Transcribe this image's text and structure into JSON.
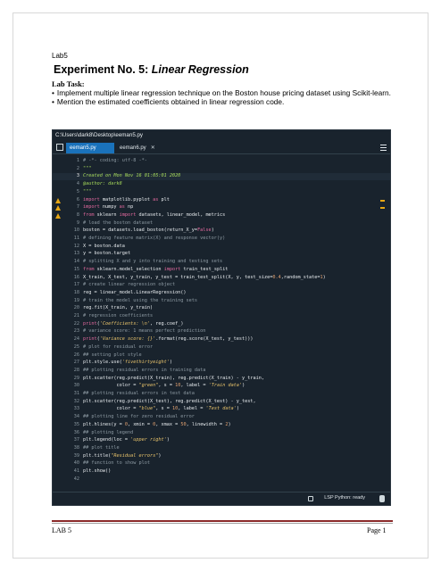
{
  "header": {
    "lab_tag": "Lab5",
    "title_prefix": "Experiment No. 5: ",
    "title_topic": "Linear Regression",
    "task_label": "Lab Task:",
    "bullets": [
      "Implement multiple linear regression technique on the Boston house pricing dataset using Scikit-learn.",
      "Mention the estimated coefficients obtained in linear regression code."
    ]
  },
  "editor": {
    "path": "C:\\Users\\dark8\\Desktop\\eeman5.py",
    "tabs": [
      {
        "label": "eeman5.py",
        "active": true
      },
      {
        "label": "eeman6.py",
        "active": false
      }
    ],
    "status": "LSP Python: ready",
    "colors": {
      "background": "#19232d",
      "active_tab": "#1a72bb",
      "warning": "#e6a614"
    },
    "current_line": 3,
    "warning_lines": [
      6,
      7,
      8
    ],
    "lines": [
      {
        "n": "1",
        "segs": [
          [
            "c-comment",
            "# -*- coding: utf-8 -*-"
          ]
        ]
      },
      {
        "n": "2",
        "segs": [
          [
            "c-doc",
            "\"\"\""
          ]
        ]
      },
      {
        "n": "3",
        "segs": [
          [
            "c-doc",
            "Created on Mon Nov 16 01:05:01 2020"
          ]
        ]
      },
      {
        "n": "4",
        "segs": [
          [
            "c-doc",
            "@author: dark8"
          ]
        ]
      },
      {
        "n": "5",
        "segs": [
          [
            "c-doc",
            "\"\"\""
          ]
        ]
      },
      {
        "n": "6",
        "segs": [
          [
            "c-kw",
            "import"
          ],
          [
            "c-fn",
            " matplotlib.pyplot "
          ],
          [
            "c-kw",
            "as"
          ],
          [
            "c-fn",
            " plt"
          ]
        ]
      },
      {
        "n": "7",
        "segs": [
          [
            "c-kw",
            "import"
          ],
          [
            "c-fn",
            " numpy "
          ],
          [
            "c-kw",
            "as"
          ],
          [
            "c-fn",
            " np"
          ]
        ]
      },
      {
        "n": "8",
        "segs": [
          [
            "c-kw",
            "from"
          ],
          [
            "c-fn",
            " sklearn "
          ],
          [
            "c-kw",
            "import"
          ],
          [
            "c-fn",
            " datasets, linear_model, metrics"
          ]
        ]
      },
      {
        "n": "9",
        "segs": [
          [
            "c-comment",
            "# load the boston dataset"
          ]
        ]
      },
      {
        "n": "10",
        "segs": [
          [
            "c-fn",
            "boston = datasets.load_boston(return_X_y="
          ],
          [
            "c-kw",
            "False"
          ],
          [
            "c-fn",
            ")"
          ]
        ]
      },
      {
        "n": "11",
        "segs": [
          [
            "c-comment",
            "# defining feature matrix(X) and response vector(y)"
          ]
        ]
      },
      {
        "n": "12",
        "segs": [
          [
            "c-fn",
            "X = boston.data"
          ]
        ]
      },
      {
        "n": "13",
        "segs": [
          [
            "c-fn",
            "y = boston.target"
          ]
        ]
      },
      {
        "n": "14",
        "segs": [
          [
            "c-comment",
            "# splitting X and y into training and testing sets"
          ]
        ]
      },
      {
        "n": "15",
        "segs": [
          [
            "c-kw",
            "from"
          ],
          [
            "c-fn",
            " sklearn.model_selection "
          ],
          [
            "c-kw",
            "import"
          ],
          [
            "c-fn",
            " train_test_split"
          ]
        ]
      },
      {
        "n": "16",
        "segs": [
          [
            "c-fn",
            "X_train, X_test, y_train, y_test = train_test_split(X, y, test_size="
          ],
          [
            "c-num",
            "0.4"
          ],
          [
            "c-fn",
            ",random_state="
          ],
          [
            "c-num",
            "1"
          ],
          [
            "c-fn",
            ")"
          ]
        ]
      },
      {
        "n": "17",
        "segs": [
          [
            "c-comment",
            "# create linear regression object"
          ]
        ]
      },
      {
        "n": "18",
        "segs": [
          [
            "c-fn",
            "reg = linear_model.LinearRegression()"
          ]
        ]
      },
      {
        "n": "19",
        "segs": [
          [
            "c-comment",
            "# train the model using the training sets"
          ]
        ]
      },
      {
        "n": "20",
        "segs": [
          [
            "c-fn",
            "reg.fit(X_train, y_train)"
          ]
        ]
      },
      {
        "n": "21",
        "segs": [
          [
            "c-comment",
            "# regression coefficients"
          ]
        ]
      },
      {
        "n": "22",
        "segs": [
          [
            "c-kw",
            "print"
          ],
          [
            "c-fn",
            "("
          ],
          [
            "c-str",
            "'Coefficients: \\n'"
          ],
          [
            "c-fn",
            ", reg.coef_)"
          ]
        ]
      },
      {
        "n": "23",
        "segs": [
          [
            "c-comment",
            "# variance score: 1 means perfect prediction"
          ]
        ]
      },
      {
        "n": "24",
        "segs": [
          [
            "c-kw",
            "print"
          ],
          [
            "c-fn",
            "("
          ],
          [
            "c-str",
            "'Variance score: {}'"
          ],
          [
            "c-fn",
            ".format(reg.score(X_test, y_test)))"
          ]
        ]
      },
      {
        "n": "25",
        "segs": [
          [
            "c-comment",
            "# plot for residual error"
          ]
        ]
      },
      {
        "n": "26",
        "segs": [
          [
            "c-comment",
            "## setting plot style"
          ]
        ]
      },
      {
        "n": "27",
        "segs": [
          [
            "c-fn",
            "plt.style.use("
          ],
          [
            "c-str",
            "'fivethirtyeight'"
          ],
          [
            "c-fn",
            ")"
          ]
        ]
      },
      {
        "n": "28",
        "segs": [
          [
            "c-comment",
            "## plotting residual errors in training data"
          ]
        ]
      },
      {
        "n": "29",
        "segs": [
          [
            "c-fn",
            "plt.scatter(reg.predict(X_train), reg.predict(X_train) - y_train,"
          ]
        ]
      },
      {
        "n": "30",
        "segs": [
          [
            "c-fn",
            "            color = "
          ],
          [
            "c-str",
            "\"green\""
          ],
          [
            "c-fn",
            ", s = "
          ],
          [
            "c-num",
            "10"
          ],
          [
            "c-fn",
            ", label = "
          ],
          [
            "c-str",
            "'Train data'"
          ],
          [
            "c-fn",
            ")"
          ]
        ]
      },
      {
        "n": "31",
        "segs": [
          [
            "c-comment",
            "## plotting residual errors in test data"
          ]
        ]
      },
      {
        "n": "32",
        "segs": [
          [
            "c-fn",
            "plt.scatter(reg.predict(X_test), reg.predict(X_test) - y_test,"
          ]
        ]
      },
      {
        "n": "33",
        "segs": [
          [
            "c-fn",
            "            color = "
          ],
          [
            "c-str",
            "\"blue\""
          ],
          [
            "c-fn",
            ", s = "
          ],
          [
            "c-num",
            "10"
          ],
          [
            "c-fn",
            ", label = "
          ],
          [
            "c-str",
            "'Test data'"
          ],
          [
            "c-fn",
            ")"
          ]
        ]
      },
      {
        "n": "34",
        "segs": [
          [
            "c-comment",
            "## plotting line for zero residual error"
          ]
        ]
      },
      {
        "n": "35",
        "segs": [
          [
            "c-fn",
            "plt.hlines(y = "
          ],
          [
            "c-num",
            "0"
          ],
          [
            "c-fn",
            ", xmin = "
          ],
          [
            "c-num",
            "0"
          ],
          [
            "c-fn",
            ", xmax = "
          ],
          [
            "c-num",
            "50"
          ],
          [
            "c-fn",
            ", linewidth = "
          ],
          [
            "c-num",
            "2"
          ],
          [
            "c-fn",
            ")"
          ]
        ]
      },
      {
        "n": "36",
        "segs": [
          [
            "c-comment",
            "## plotting legend"
          ]
        ]
      },
      {
        "n": "37",
        "segs": [
          [
            "c-fn",
            "plt.legend(loc = "
          ],
          [
            "c-str",
            "'upper right'"
          ],
          [
            "c-fn",
            ")"
          ]
        ]
      },
      {
        "n": "38",
        "segs": [
          [
            "c-comment",
            "## plot title"
          ]
        ]
      },
      {
        "n": "39",
        "segs": [
          [
            "c-fn",
            "plt.title("
          ],
          [
            "c-str",
            "\"Residual errors\""
          ],
          [
            "c-fn",
            ")"
          ]
        ]
      },
      {
        "n": "40",
        "segs": [
          [
            "c-comment",
            "## function to show plot"
          ]
        ]
      },
      {
        "n": "41",
        "segs": [
          [
            "c-fn",
            "plt.show()"
          ]
        ]
      },
      {
        "n": "42",
        "segs": []
      }
    ]
  },
  "footer": {
    "left": "LAB 5",
    "right": "Page 1"
  }
}
